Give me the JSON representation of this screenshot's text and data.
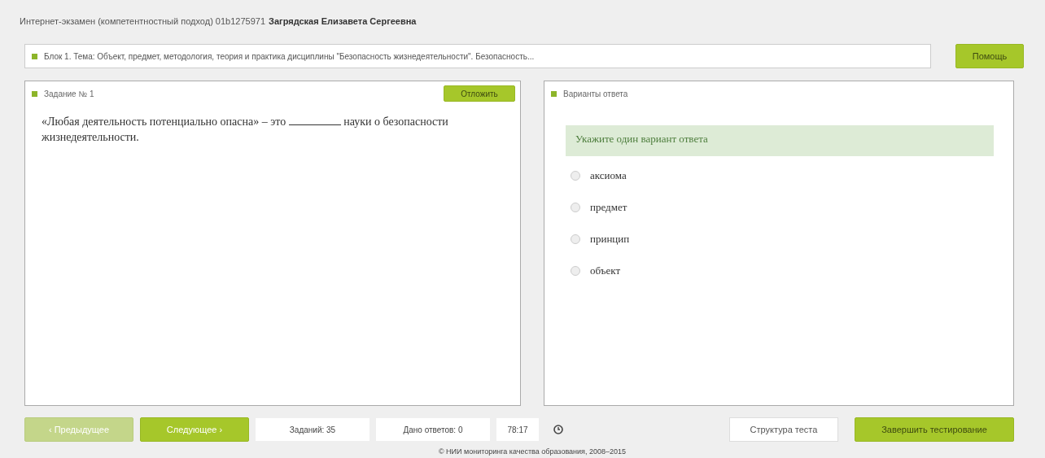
{
  "header": {
    "title": "Интернет-экзамен (компетентностный подход) 01b1275971",
    "student": "Загрядская Елизавета Сергеевна"
  },
  "block": {
    "text": "Блок 1. Тема: Объект, предмет, методология, теория и практика дисциплины \"Безопасность жизнедеятельности\". Безопасность..."
  },
  "help_button": "Помощь",
  "task": {
    "title": "Задание № 1",
    "action_button": "Отложить",
    "question_before": "«Любая деятельность потенциально опасна» – это",
    "question_after": "науки о безопасности жизнедеятельности."
  },
  "answers": {
    "title": "Варианты ответа",
    "hint": "Укажите один вариант ответа",
    "options": [
      {
        "label": "аксиома",
        "selected": false
      },
      {
        "label": "предмет",
        "selected": false
      },
      {
        "label": "принцип",
        "selected": false
      },
      {
        "label": "объект",
        "selected": false
      }
    ]
  },
  "footer_bar": {
    "prev": {
      "label": "‹ Предыдущее",
      "disabled": true
    },
    "next": {
      "label": "Следующее ›",
      "disabled": false
    },
    "tasks_count": "Заданий: 35",
    "answered": "Дано ответов: 0",
    "timer": "78:17",
    "structure_button": "Структура теста",
    "finish_button": "Завершить тестирование"
  },
  "copyright": "© НИИ мониторинга качества образования, 2008–2015"
}
